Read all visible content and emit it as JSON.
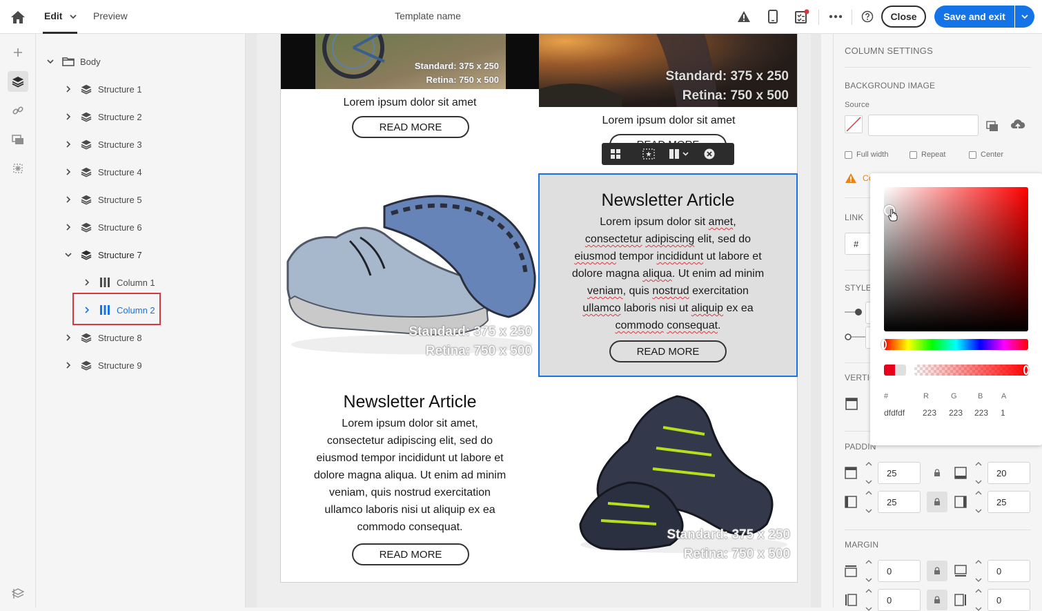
{
  "topbar": {
    "edit_label": "Edit",
    "preview_label": "Preview",
    "template_name": "Template name",
    "close_label": "Close",
    "save_label": "Save and exit"
  },
  "tree": {
    "root": "Body",
    "structures": [
      {
        "label": "Structure 1"
      },
      {
        "label": "Structure 2"
      },
      {
        "label": "Structure 3"
      },
      {
        "label": "Structure 4"
      },
      {
        "label": "Structure 5"
      },
      {
        "label": "Structure 6"
      },
      {
        "label": "Structure 7"
      },
      {
        "label": "Structure 8"
      },
      {
        "label": "Structure 9"
      }
    ],
    "columns": [
      {
        "label": "Column 1"
      },
      {
        "label": "Column 2"
      }
    ],
    "selected": "Column 2"
  },
  "email": {
    "placeholder_standard": "Standard: 375 x 250",
    "placeholder_retina": "Retina: 750 x 500",
    "lorem_head": "Lorem ipsum dolor sit amet",
    "read_more": "READ MORE",
    "article_title": "Newsletter Article",
    "article_lines": [
      "Lorem ipsum dolor sit amet,",
      "consectetur adipiscing elit, sed do",
      "eiusmod tempor incididunt ut labore et",
      "dolore magna aliqua. Ut enim ad minim",
      "veniam, quis nostrud exercitation",
      "ullamco laboris nisi ut aliquip ex ea",
      "commodo consequat."
    ],
    "selected_background": "#dfdfdf"
  },
  "column_settings": {
    "title": "COLUMN SETTINGS",
    "background_image": "BACKGROUND IMAGE",
    "source_label": "Source",
    "source_value": "",
    "full_width": "Full width",
    "repeat": "Repeat",
    "center": "Center",
    "warning_prefix": "Co",
    "link": "LINK",
    "link_value": "#",
    "style": "STYLE",
    "vertical": "VERTIC",
    "padding": "PADDIN",
    "padding_top": "25",
    "padding_bottom": "20",
    "padding_left": "25",
    "padding_right": "25",
    "margin": "MARGIN",
    "margin_top": "0",
    "margin_bottom": "0",
    "margin_left": "0",
    "margin_right": "0"
  },
  "color_picker": {
    "hash_label": "#",
    "r_label": "R",
    "g_label": "G",
    "b_label": "B",
    "a_label": "A",
    "hex": "dfdfdf",
    "r": "223",
    "g": "223",
    "b": "223",
    "a": "1"
  },
  "colors": {
    "accent": "#1473e6",
    "selection_outline": "#d7373f",
    "warning": "#e68619"
  }
}
